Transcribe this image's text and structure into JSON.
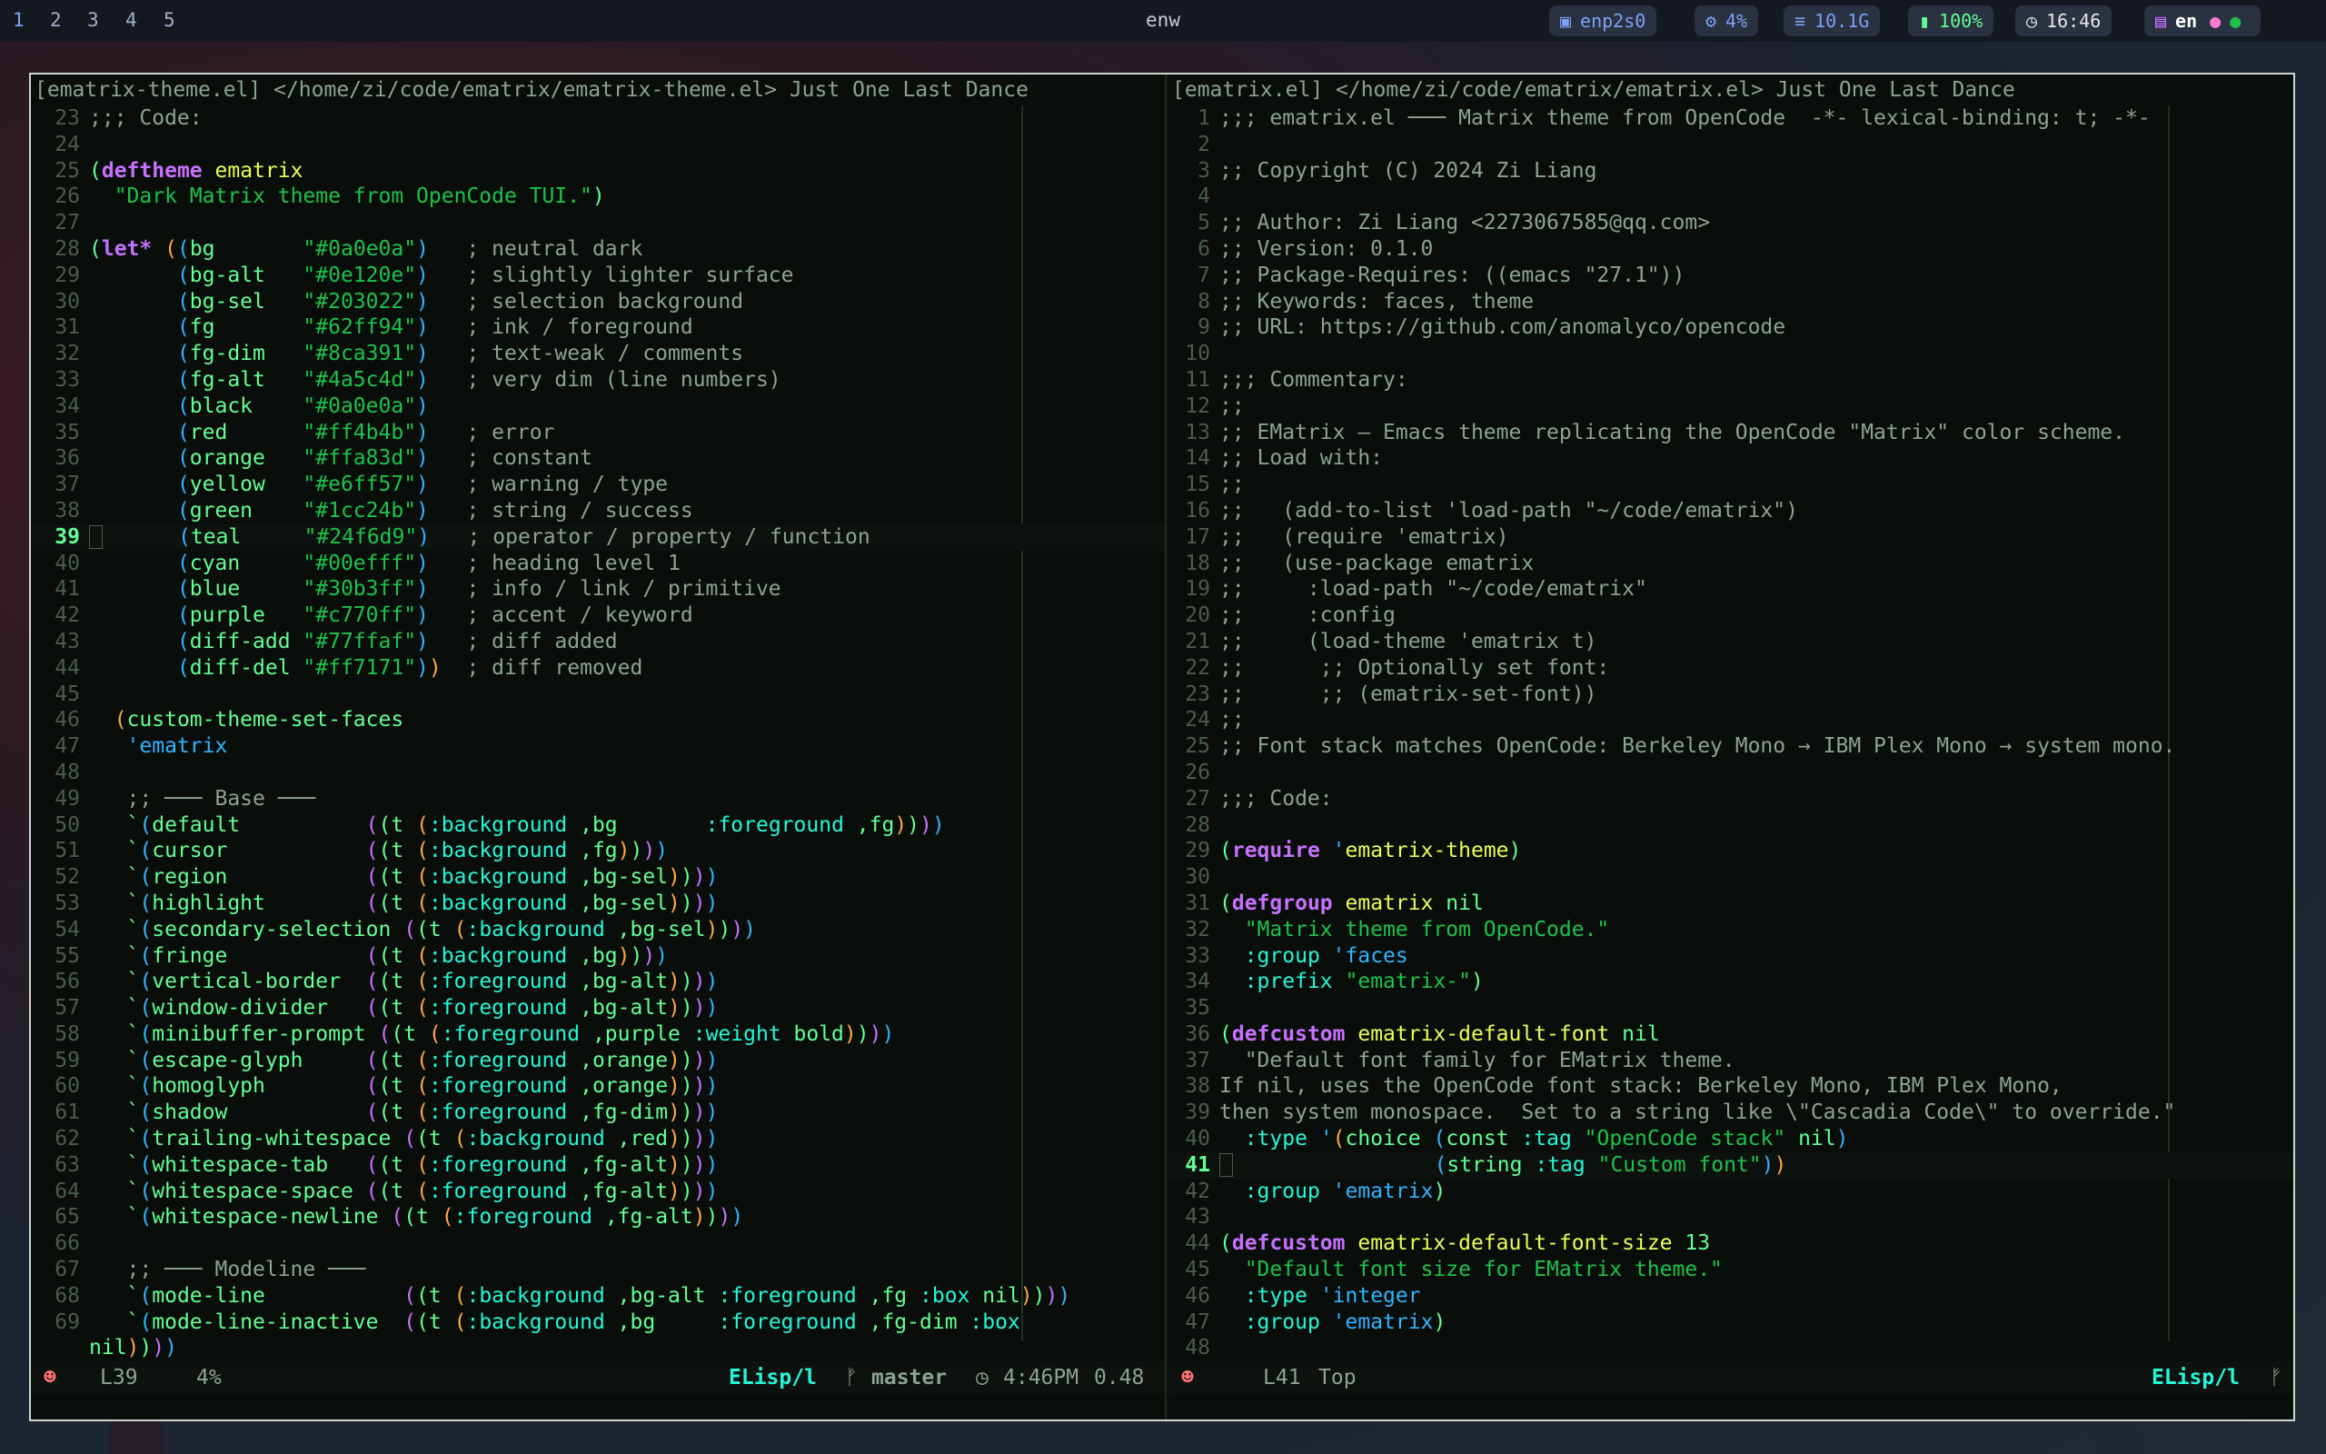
{
  "topbar": {
    "workspaces": [
      "1",
      "2",
      "3",
      "4",
      "5"
    ],
    "window_title": "enw",
    "network": "enp2s0",
    "cpu": "4%",
    "memory": "10.1G",
    "battery": "100%",
    "clock": "16:46",
    "lang": "en"
  },
  "left": {
    "header": "[ematrix-theme.el] </home/zi/code/ematrix/ematrix-theme.el> Just One Last Dance",
    "modeline": {
      "position": "L39",
      "percent": "4%",
      "mode": "ELisp/l",
      "branch": "master",
      "time": "4:46PM",
      "load": "0.48"
    }
  },
  "right": {
    "header": "[ematrix.el] </home/zi/code/ematrix/ematrix.el> Just One Last Dance",
    "modeline": {
      "position": "L41",
      "scroll": "Top",
      "mode": "ELisp/l"
    }
  },
  "colors": {
    "bg": "#0a0e0a",
    "fg": "#62ff94",
    "dim": "#8ca391",
    "keyword": "#c770ff",
    "func": "#e6ff57",
    "string": "#1cc24b",
    "teal": "#24f6d9"
  }
}
